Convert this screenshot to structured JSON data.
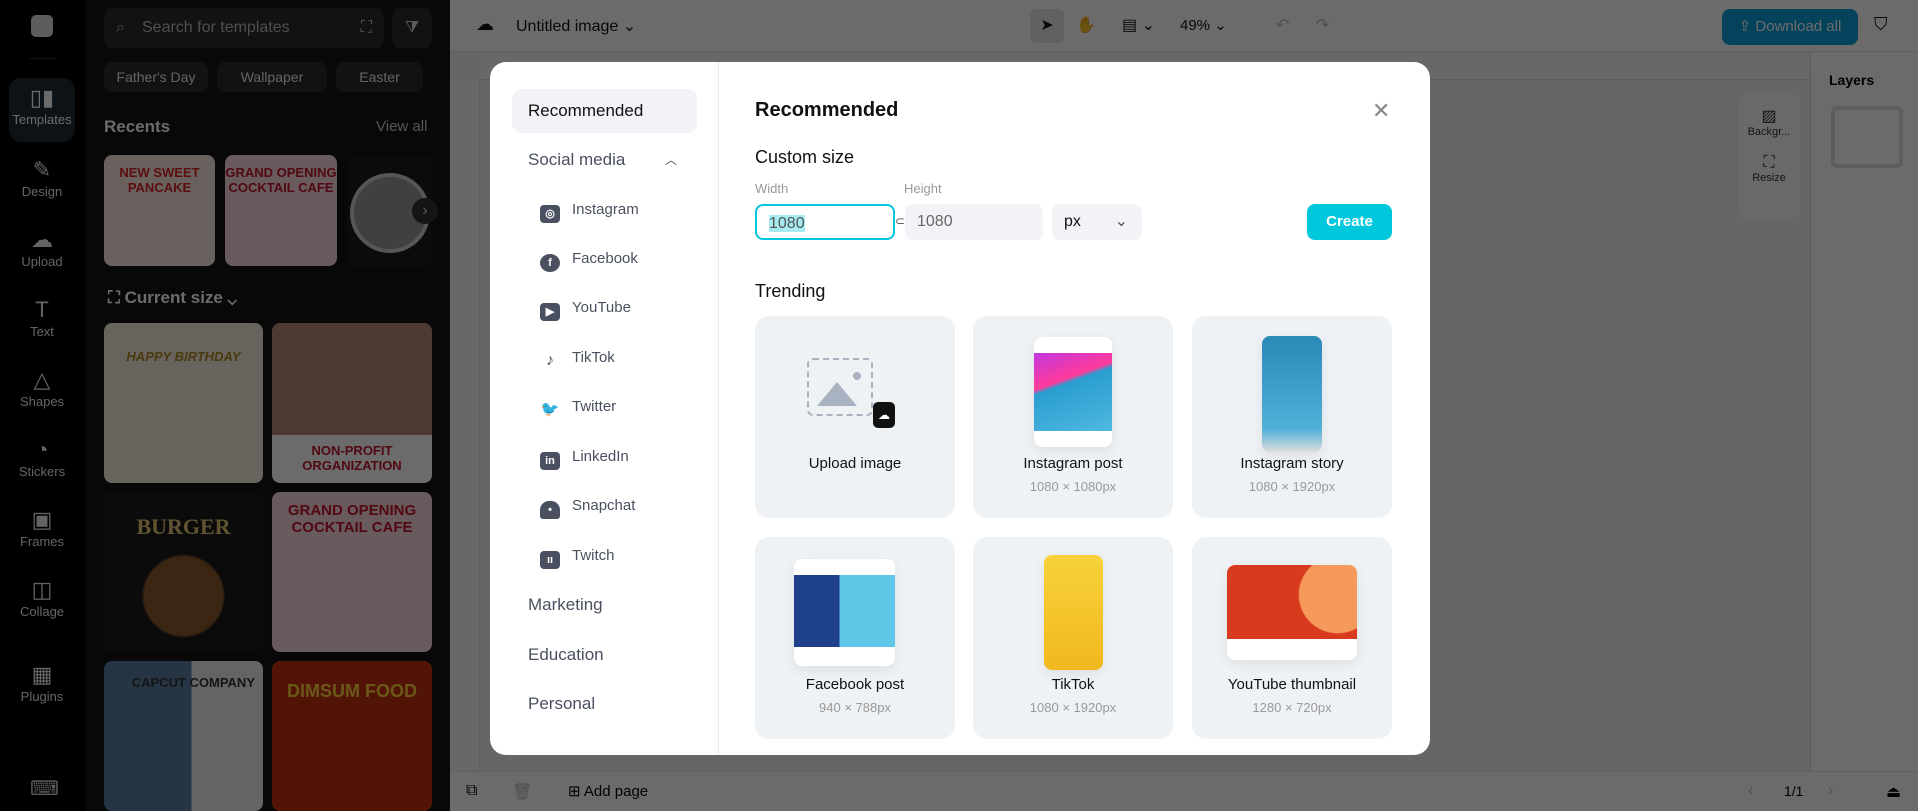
{
  "rail": {
    "items": [
      {
        "label": "Templates",
        "icon": "templates-icon"
      },
      {
        "label": "Design",
        "icon": "design-icon"
      },
      {
        "label": "Upload",
        "icon": "upload-icon"
      },
      {
        "label": "Text",
        "icon": "text-icon"
      },
      {
        "label": "Shapes",
        "icon": "shapes-icon"
      },
      {
        "label": "Stickers",
        "icon": "stickers-icon"
      },
      {
        "label": "Frames",
        "icon": "frames-icon"
      },
      {
        "label": "Collage",
        "icon": "collage-icon"
      },
      {
        "label": "Plugins",
        "icon": "plugins-icon"
      }
    ]
  },
  "panel": {
    "search_placeholder": "Search for templates",
    "chips": [
      "Father's Day",
      "Wallpaper",
      "Easter"
    ],
    "recents_title": "Recents",
    "view_all": "View all",
    "current_size": "Current size",
    "recents": [
      "NEW SWEET PANCAKE",
      "GRAND OPENING COCKTAIL CAFE",
      ""
    ],
    "templates": [
      "HAPPY BIRTHDAY",
      "NON-PROFIT ORGANIZATION",
      "BURGER",
      "GRAND OPENING COCKTAIL CAFE",
      "CAPCUT COMPANY",
      "DIMSUM FOOD"
    ]
  },
  "topbar": {
    "title": "Untitled image",
    "zoom": "49%",
    "download": "Download all"
  },
  "canvas_tools": {
    "background": "Backgr...",
    "resize": "Resize"
  },
  "layers": {
    "title": "Layers"
  },
  "bottombar": {
    "add_page": "Add page",
    "page": "1/1"
  },
  "modal": {
    "nav": {
      "recommended": "Recommended",
      "social": "Social media",
      "social_items": [
        "Instagram",
        "Facebook",
        "YouTube",
        "TikTok",
        "Twitter",
        "LinkedIn",
        "Snapchat",
        "Twitch"
      ],
      "marketing": "Marketing",
      "education": "Education",
      "personal": "Personal"
    },
    "title": "Recommended",
    "custom_size": "Custom size",
    "width_label": "Width",
    "height_label": "Height",
    "width_value": "1080",
    "height_value": "1080",
    "unit": "px",
    "create": "Create",
    "trending": "Trending",
    "cards": [
      {
        "title": "Upload image",
        "size": ""
      },
      {
        "title": "Instagram post",
        "size": "1080 × 1080px"
      },
      {
        "title": "Instagram story",
        "size": "1080 × 1920px"
      },
      {
        "title": "Facebook post",
        "size": "940 × 788px"
      },
      {
        "title": "TikTok",
        "size": "1080 × 1920px"
      },
      {
        "title": "YouTube thumbnail",
        "size": "1280 × 720px"
      }
    ]
  },
  "colors": {
    "accent": "#00c8dc",
    "download": "#0a9fd8"
  }
}
